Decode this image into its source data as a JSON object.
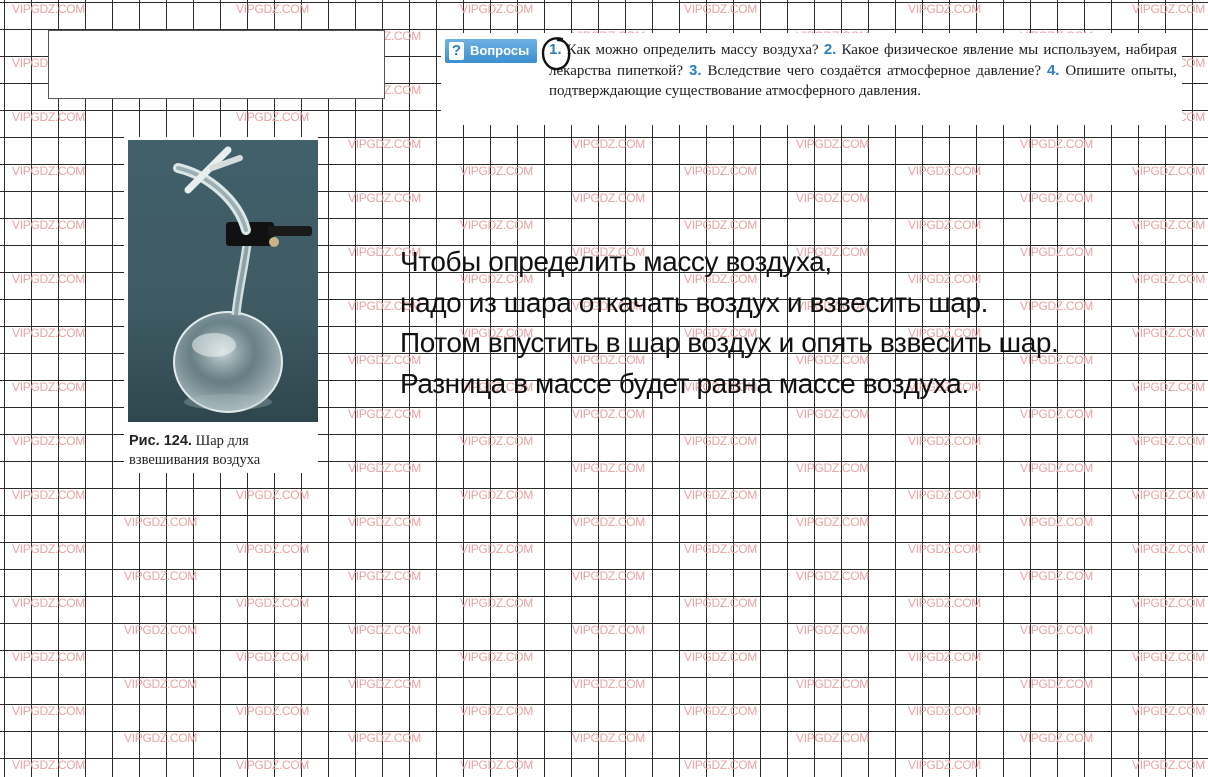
{
  "watermark": "VIPGDZ.COM",
  "questions": {
    "tag_label": "Вопросы",
    "tag_icon": "question-mark-icon",
    "items": [
      {
        "num": "1.",
        "text": "Как можно определить массу воздуха?"
      },
      {
        "num": "2.",
        "text": "Какое физическое явление мы используем, набирая лекарства пипеткой?"
      },
      {
        "num": "3.",
        "text": "Вследствие чего создаётся атмосферное давление?"
      },
      {
        "num": "4.",
        "text": "Опишите опыты, подтверждающие существование атмосферного давления."
      }
    ]
  },
  "figure": {
    "label": "Рис. 124.",
    "caption": "Шар для взвешивания воздуха"
  },
  "answer": {
    "lines": [
      "Чтобы определить массу воздуха,",
      "надо из шара откачать воздух и взвесить шар.",
      "Потом впустить в шар воздух и опять взвесить шар.",
      "Разница в массе будет равна массе воздуха."
    ]
  },
  "colors": {
    "grid": "#2b2b2b",
    "watermark": "#e9a3a3",
    "question_number": "#2a7fc2",
    "tag_background": "#3b8fd0"
  }
}
